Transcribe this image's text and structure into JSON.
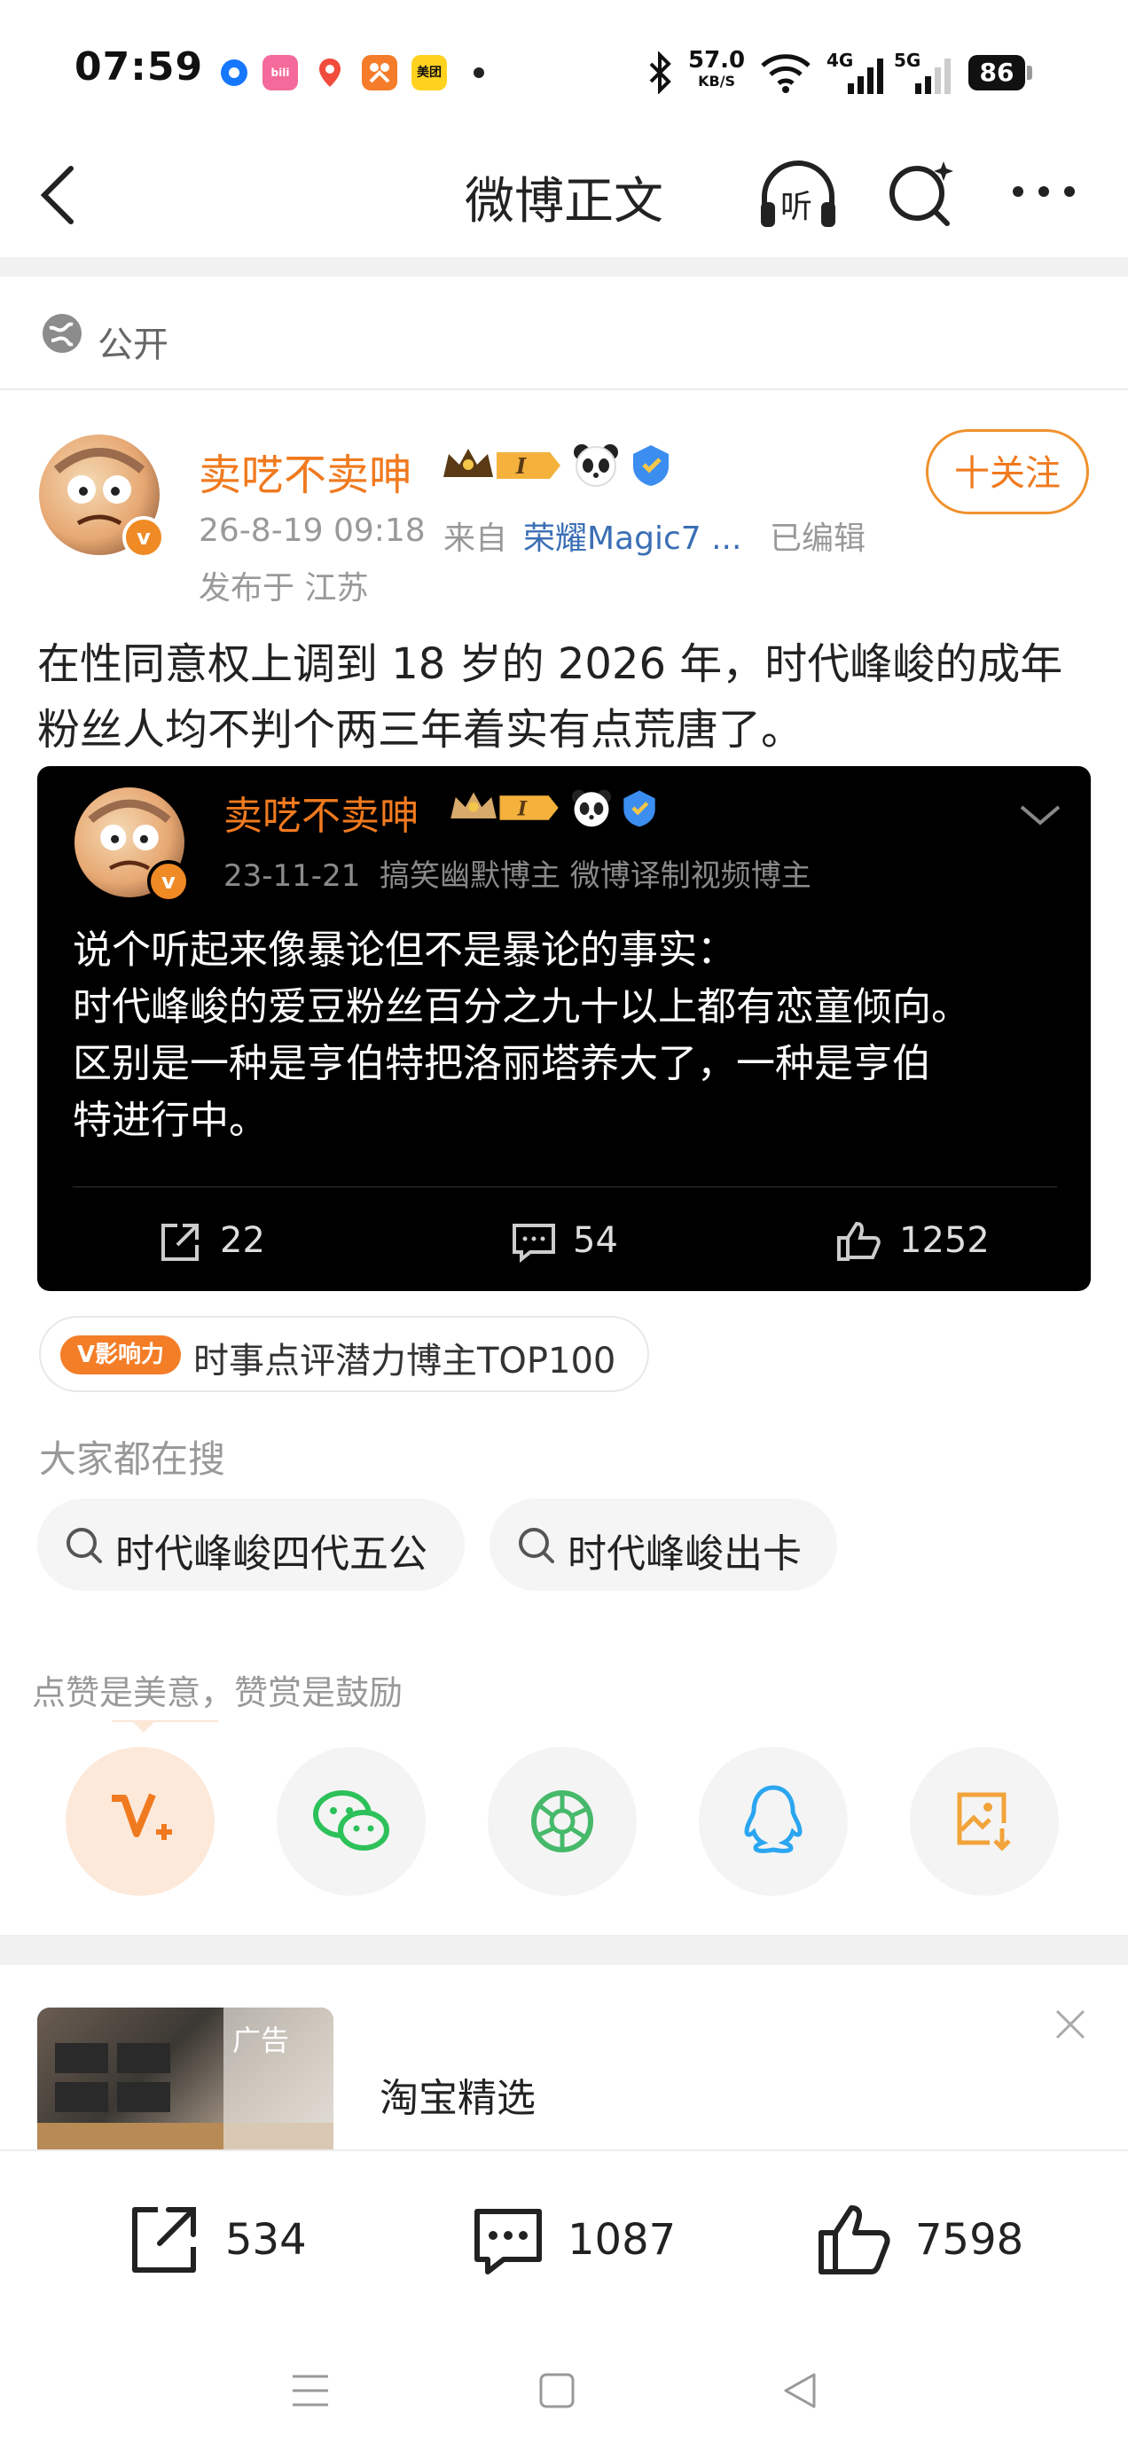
{
  "status_bar": {
    "time": "07:59",
    "net_speed": "57.0",
    "net_unit": "KB/S",
    "signal1": "4G",
    "signal2": "5G",
    "battery": "86"
  },
  "header": {
    "title": "微博正文",
    "listen_label": "听"
  },
  "visibility": {
    "label": "公开"
  },
  "author": {
    "name": "卖呓不卖呻",
    "time": "26-8-19 09:18",
    "source_prefix": "来自",
    "source": "荣耀Magic7 ...",
    "edited": "已编辑",
    "location": "发布于 江苏",
    "follow_label": "十关注"
  },
  "post": {
    "text": "在性同意权上调到 18 岁的 2026 年，时代峰峻的成年粉丝人均不判个两三年着实有点荒唐了。"
  },
  "quoted": {
    "name": "卖呓不卖呻",
    "time": "23-11-21",
    "tags": "搞笑幽默博主 微博译制视频博主",
    "text_lines": [
      "说个听起来像暴论但不是暴论的事实：",
      "时代峰峻的爱豆粉丝百分之九十以上都有恋童倾向。",
      "区别是一种是亨伯特把洛丽塔养大了，一种是亨伯",
      "特进行中。"
    ],
    "reposts": "22",
    "comments": "54",
    "likes": "1252"
  },
  "influence": {
    "tag": "V影响力",
    "text": "时事点评潜力博主TOP100"
  },
  "search": {
    "title": "大家都在搜",
    "chips": [
      "时代峰峻四代五公",
      "时代峰峻出卡"
    ]
  },
  "reward": {
    "text": "点赞是美意，赞赏是鼓励"
  },
  "ad": {
    "tag": "广告",
    "title": "淘宝精选"
  },
  "bottom_bar": {
    "reposts": "534",
    "comments": "1087",
    "likes": "7598"
  },
  "colors": {
    "accent": "#f07a1f",
    "wechat": "#2dc15a",
    "moments": "#46b96a",
    "qq": "#2aa6f0",
    "save": "#f2a33a"
  }
}
